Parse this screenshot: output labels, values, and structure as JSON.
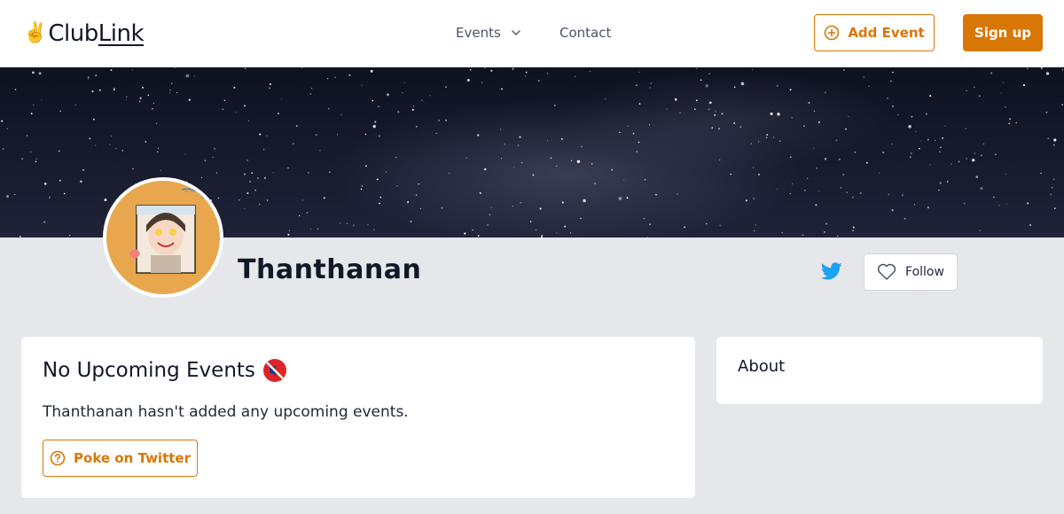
{
  "nav": {
    "logo": {
      "hand": "✌️",
      "club": "Club",
      "link": "Link"
    },
    "events_label": "Events",
    "contact_label": "Contact",
    "add_event_label": "Add Event",
    "signup_label": "Sign up"
  },
  "profile": {
    "name": "Thanthanan",
    "follow_label": "Follow",
    "avatar_bg": "#e8a74e"
  },
  "events_card": {
    "title": "No Upcoming Events",
    "title_emoji_icon": "muted-speaker-icon",
    "message": "Thanthanan hasn't added any upcoming events.",
    "poke_label": "Poke on Twitter"
  },
  "about_card": {
    "title": "About"
  },
  "colors": {
    "accent": "#d97706",
    "twitter": "#1da1f2",
    "page_bg": "#e5e7eb"
  }
}
